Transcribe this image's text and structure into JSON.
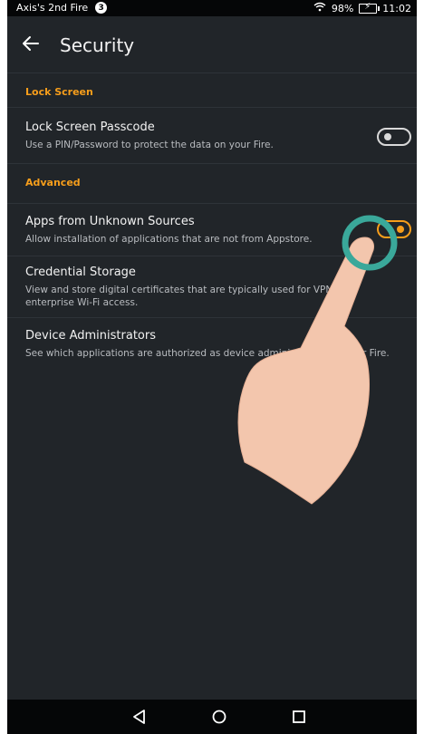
{
  "status_bar": {
    "device_name": "Axis's 2nd Fire",
    "notification_count": "3",
    "battery": "98%",
    "time": "11:02",
    "icons": [
      "wifi-icon",
      "battery-charging-icon"
    ]
  },
  "app_bar": {
    "title": "Security",
    "back_icon": "arrow-left-icon"
  },
  "sections": {
    "lock_screen": {
      "header": "Lock Screen",
      "passcode_title": "Lock Screen Passcode",
      "passcode_subtitle": "Use a PIN/Password to protect the data on your Fire.",
      "passcode_enabled": false
    },
    "advanced": {
      "header": "Advanced",
      "unknown_sources_title": "Apps from Unknown Sources",
      "unknown_sources_subtitle": "Allow installation of applications that are not from Appstore.",
      "unknown_sources_enabled": true,
      "credential_title": "Credential Storage",
      "credential_subtitle": "View and store digital certificates that are typically used for VPN and enterprise Wi-Fi access.",
      "device_admin_title": "Device Administrators",
      "device_admin_subtitle": "See which applications are authorized as device administrators on your Fire."
    }
  },
  "nav_bar": {
    "icons": [
      "back-triangle-icon",
      "home-circle-icon",
      "recents-square-icon"
    ]
  },
  "colors": {
    "accent": "#f79e1b",
    "background": "#212529",
    "touch_ring": "#3aa89a",
    "hand": "#f3c6ad"
  }
}
